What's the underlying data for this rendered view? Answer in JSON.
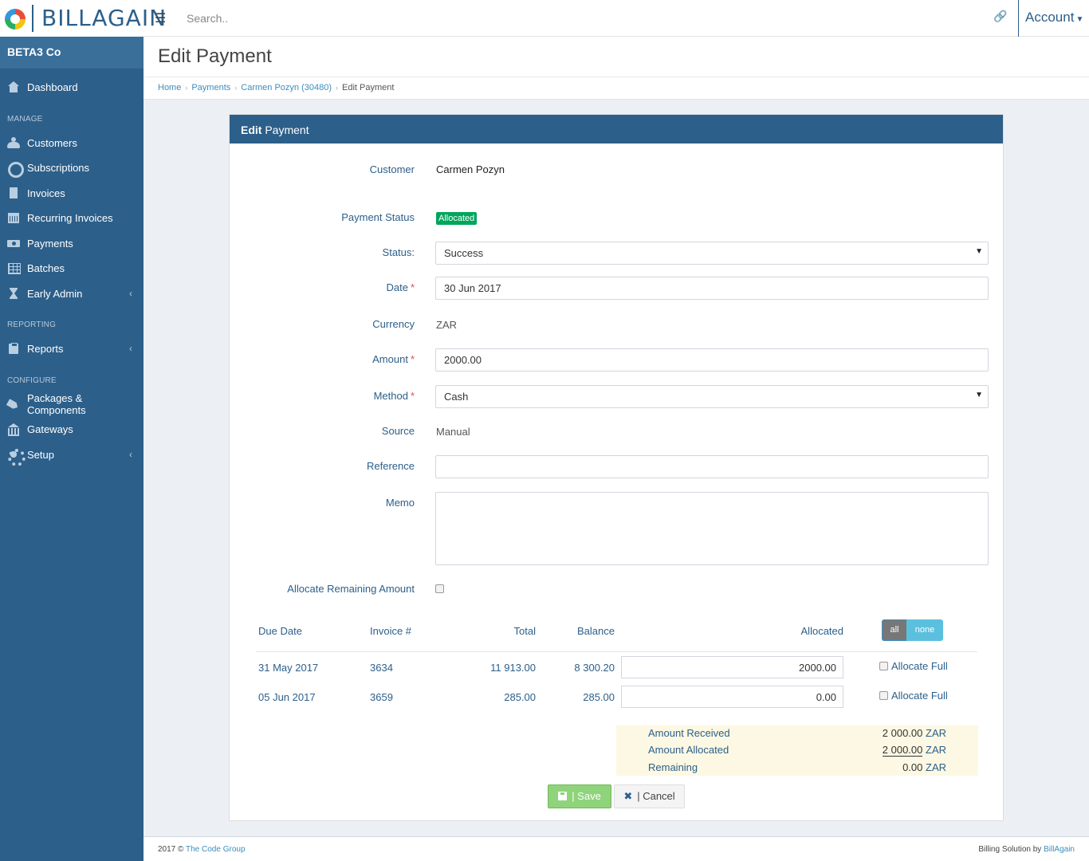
{
  "brand": {
    "name": "BILLAGAIN"
  },
  "topbar": {
    "search_placeholder": "Search..",
    "account_label": "Account"
  },
  "sidebar": {
    "company": "BETA3 Co",
    "dashboard": "Dashboard",
    "manage_heading": "MANAGE",
    "manage_items": [
      "Customers",
      "Subscriptions",
      "Invoices",
      "Recurring Invoices",
      "Payments",
      "Batches",
      "Early Admin"
    ],
    "reporting_heading": "REPORTING",
    "reporting_items": [
      "Reports"
    ],
    "configure_heading": "CONFIGURE",
    "configure_items": [
      "Packages & Components",
      "Gateways",
      "Setup"
    ]
  },
  "page": {
    "title": "Edit Payment",
    "breadcrumb": [
      "Home",
      "Payments",
      "Carmen Pozyn (30480)",
      "Edit Payment"
    ]
  },
  "panel": {
    "title_bold": "Edit",
    "title_rest": " Payment"
  },
  "form": {
    "customer_label": "Customer",
    "customer_value": "Carmen Pozyn",
    "payment_status_label": "Payment Status",
    "payment_status_value": "Allocated",
    "status_label": "Status:",
    "status_value": "Success",
    "date_label": "Date",
    "date_value": "30 Jun 2017",
    "currency_label": "Currency",
    "currency_value": "ZAR",
    "amount_label": "Amount",
    "amount_value": "2000.00",
    "method_label": "Method",
    "method_value": "Cash",
    "source_label": "Source",
    "source_value": "Manual",
    "reference_label": "Reference",
    "reference_value": "",
    "memo_label": "Memo",
    "memo_value": "",
    "allocate_remaining_label": "Allocate Remaining Amount",
    "required_mark": "*"
  },
  "allocation": {
    "headers": {
      "due_date": "Due Date",
      "invoice": "Invoice #",
      "total": "Total",
      "balance": "Balance",
      "allocated": "Allocated"
    },
    "toggle_all": "all",
    "toggle_none": "none",
    "allocate_full_label": "Allocate Full",
    "rows": [
      {
        "due_date": "31 May 2017",
        "invoice": "3634",
        "total": "11 913.00",
        "balance": "8 300.20",
        "allocated": "2000.00"
      },
      {
        "due_date": "05 Jun 2017",
        "invoice": "3659",
        "total": "285.00",
        "balance": "285.00",
        "allocated": "0.00"
      }
    ]
  },
  "summary": {
    "received_label": "Amount Received",
    "received_value": "2 000.00",
    "allocated_label": "Amount Allocated",
    "allocated_value": "2 000.00",
    "remaining_label": "Remaining",
    "remaining_value": "0.00",
    "currency": "ZAR"
  },
  "actions": {
    "save": "| Save",
    "cancel": "| Cancel"
  },
  "footer": {
    "copyright": "2017 ©",
    "company_link": "The Code Group",
    "right_text": "Billing Solution by",
    "right_link": "BillAgain"
  }
}
